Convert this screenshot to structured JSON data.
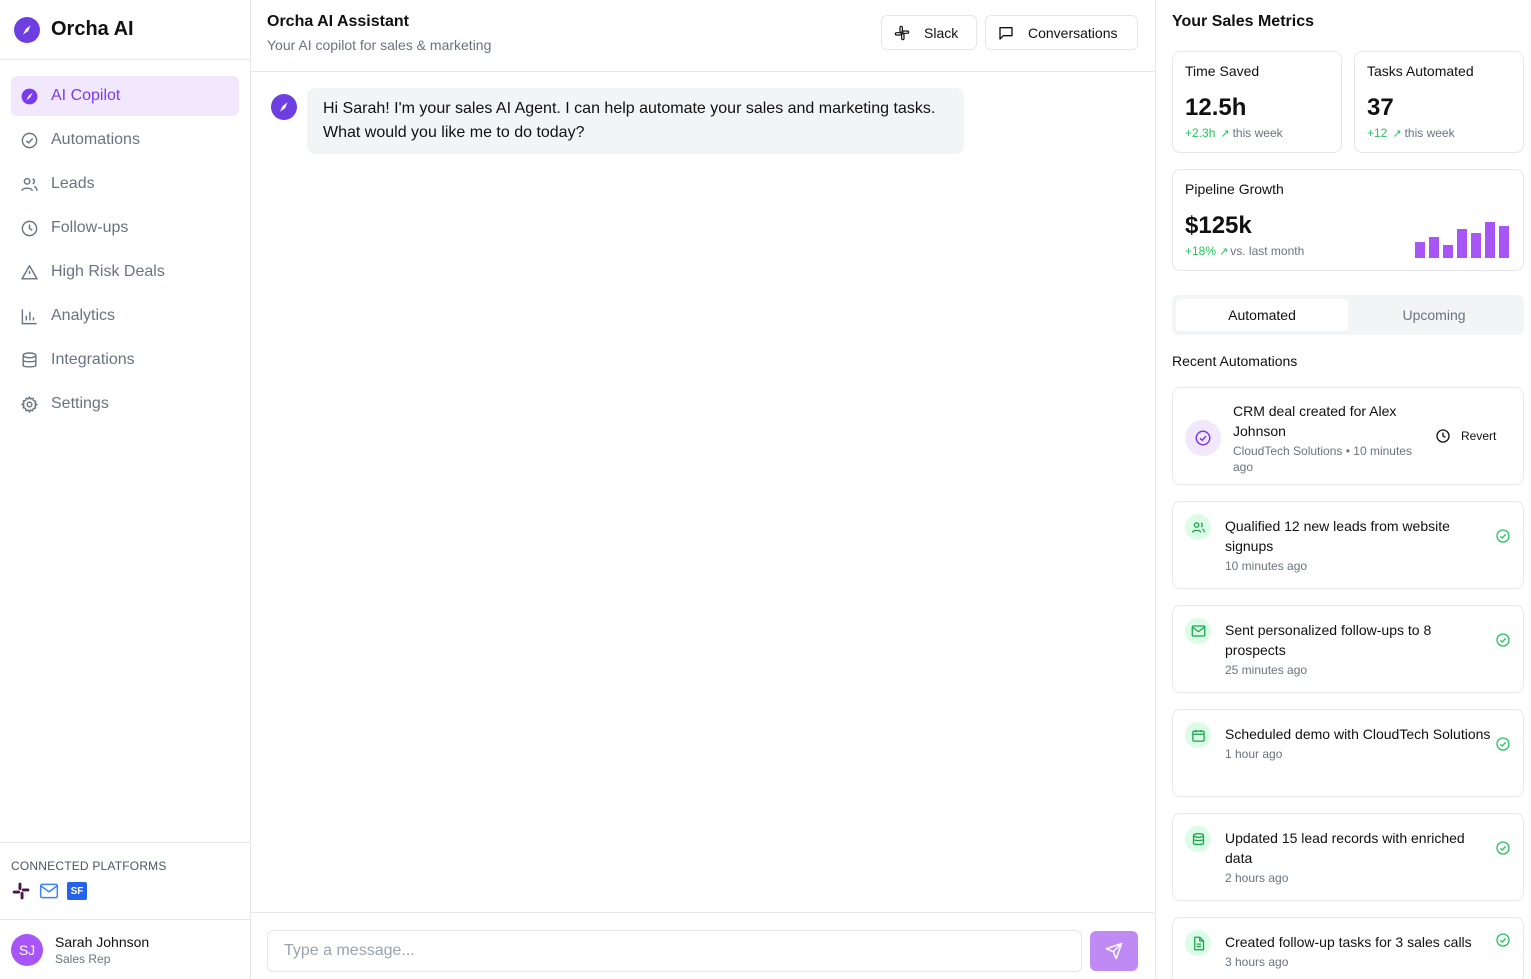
{
  "brand": {
    "name": "Orcha AI"
  },
  "sidebar": {
    "items": [
      {
        "label": "AI Copilot",
        "icon": "compass-icon",
        "active": true
      },
      {
        "label": "Automations",
        "icon": "check-circle-icon"
      },
      {
        "label": "Leads",
        "icon": "users-icon"
      },
      {
        "label": "Follow-ups",
        "icon": "clock-icon"
      },
      {
        "label": "High Risk Deals",
        "icon": "warning-icon"
      },
      {
        "label": "Analytics",
        "icon": "bar-chart-icon"
      },
      {
        "label": "Integrations",
        "icon": "database-icon"
      },
      {
        "label": "Settings",
        "icon": "gear-icon"
      }
    ],
    "platforms_title": "CONNECTED PLATFORMS",
    "platforms": [
      "slack-icon",
      "mail-icon",
      "SF"
    ],
    "user": {
      "initials": "SJ",
      "name": "Sarah Johnson",
      "role": "Sales Rep"
    }
  },
  "chat": {
    "title": "Orcha AI Assistant",
    "subtitle": "Your AI copilot for sales & marketing",
    "slack_label": "Slack",
    "conversations_label": "Conversations",
    "message": "Hi Sarah! I'm your sales AI Agent. I can help automate your sales and marketing tasks. What would you like me to do today?",
    "input_placeholder": "Type a message..."
  },
  "metrics": {
    "title": "Your Sales Metrics",
    "time_saved": {
      "label": "Time Saved",
      "value": "12.5h",
      "change": "+2.3h",
      "period": "this week"
    },
    "tasks": {
      "label": "Tasks Automated",
      "value": "37",
      "change": "+12",
      "period": "this week"
    },
    "pipeline": {
      "label": "Pipeline Growth",
      "value": "$125k",
      "change": "+18%",
      "period": "vs. last month",
      "bar_levels": [
        0.42,
        0.55,
        0.35,
        0.75,
        0.65,
        0.95,
        0.85
      ]
    }
  },
  "tabs": {
    "automated": "Automated",
    "upcoming": "Upcoming"
  },
  "recent": {
    "title": "Recent Automations",
    "featured": {
      "text": "CRM deal created for Alex Johnson",
      "meta": "CloudTech Solutions • 10 minutes ago",
      "revert_label": "Revert"
    },
    "items": [
      {
        "text": "Qualified 12 new leads from website signups",
        "meta": "10 minutes ago",
        "icon": "users-icon"
      },
      {
        "text": "Sent personalized follow-ups to 8 prospects",
        "meta": "25 minutes ago",
        "icon": "mail-icon"
      },
      {
        "text": "Scheduled demo with CloudTech Solutions",
        "meta": "1 hour ago",
        "icon": "calendar-icon"
      },
      {
        "text": "Updated 15 lead records with enriched data",
        "meta": "2 hours ago",
        "icon": "database-icon"
      },
      {
        "text": "Created follow-up tasks for 3 sales calls",
        "meta": "3 hours ago",
        "icon": "file-icon"
      }
    ]
  },
  "colors": {
    "accent": "#7c3aed",
    "accent_light": "#f1e8fd",
    "success": "#22c55e",
    "bar": "#a855f7"
  }
}
